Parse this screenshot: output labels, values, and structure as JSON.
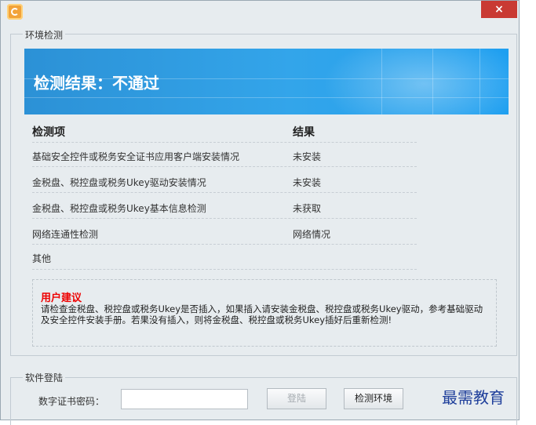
{
  "window": {
    "close_glyph": "×"
  },
  "env_group": {
    "legend": "环境检测"
  },
  "banner": {
    "result_text": "检测结果：不通过"
  },
  "table": {
    "headers": {
      "item": "检测项",
      "result": "结果"
    },
    "rows": [
      {
        "item": "基础安全控件或税务安全证书应用客户端安装情况",
        "result": "未安装"
      },
      {
        "item": "金税盘、税控盘或税务Ukey驱动安装情况",
        "result": "未安装"
      },
      {
        "item": "金税盘、税控盘或税务Ukey基本信息检测",
        "result": "未获取"
      },
      {
        "item": "网络连通性检测",
        "result": "网络情况"
      },
      {
        "item": "其他",
        "result": ""
      }
    ]
  },
  "suggestion": {
    "title": "用户建议",
    "text": "请检查金税盘、税控盘或税务Ukey是否插入，如果插入请安装金税盘、税控盘或税务Ukey驱动，参考基础驱动及安全控件安装手册。若果没有插入，则将金税盘、税控盘或税务Ukey插好后重新检测!"
  },
  "login_group": {
    "legend": "软件登陆",
    "password_label": "数字证书密码：",
    "password_value": "",
    "login_button": "登陆",
    "check_button": "检测环境"
  },
  "watermark": "最需教育",
  "colors": {
    "banner": "#2c91d6",
    "close": "#c93a33",
    "suggestion_title": "#e00000"
  }
}
